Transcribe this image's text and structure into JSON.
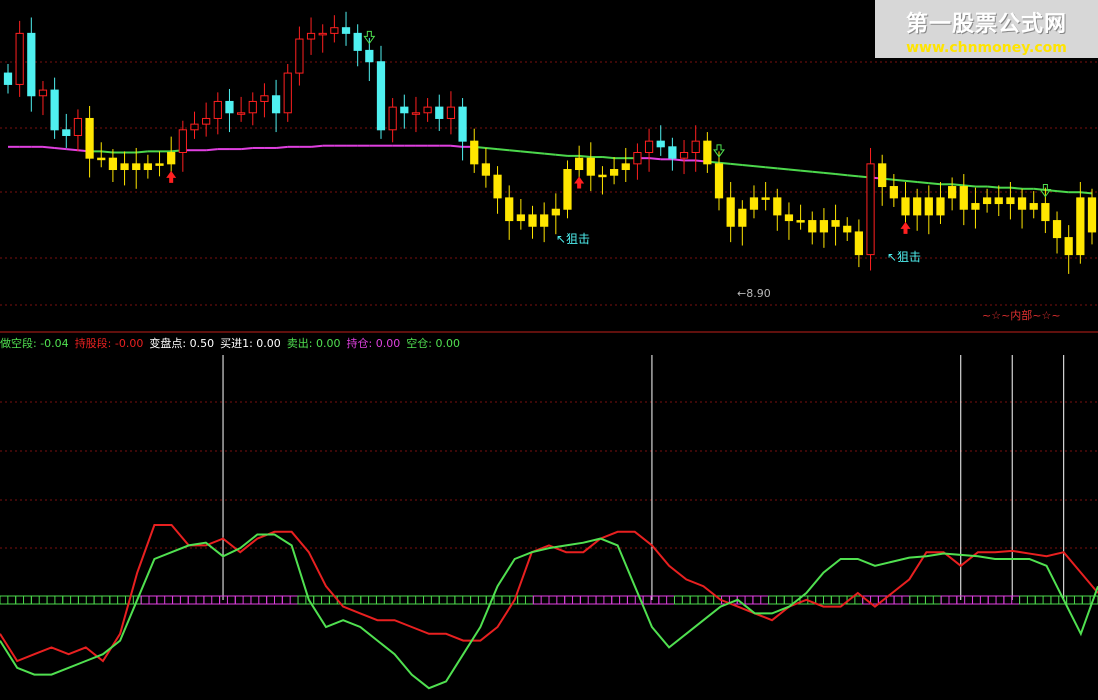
{
  "watermark": {
    "title": "第一股票公式网",
    "url": "www.chnmoney.com"
  },
  "colors": {
    "background": "#000000",
    "up": "#ff2020",
    "down": "#4ff0f0",
    "weak": "#ffe600",
    "ma_upper": "#e040e0",
    "ma_lower": "#4cd84c",
    "grid": "#7a1010",
    "line_red": "#e82020",
    "line_green": "#50e050"
  },
  "legend": [
    {
      "label": "做空段:",
      "value": "-0.04",
      "color": "#50e050"
    },
    {
      "label": "持股段:",
      "value": "-0.00",
      "color": "#e82020"
    },
    {
      "label": "变盘点:",
      "value": "0.50",
      "color": "#ffffff"
    },
    {
      "label": "买进1:",
      "value": "0.00",
      "color": "#ffffff"
    },
    {
      "label": "卖出:",
      "value": "0.00",
      "color": "#50e050"
    },
    {
      "label": "持仓:",
      "value": "0.00",
      "color": "#e040e0"
    },
    {
      "label": "空仓:",
      "value": "0.00",
      "color": "#50e050"
    }
  ],
  "annotations": {
    "snipe1": "↖狙击",
    "snipe2": "↖狙击",
    "low": "←8.90",
    "inner": "~☆~内部~☆~"
  },
  "chart_data": [
    {
      "type": "candlestick",
      "title": "",
      "ylim": [
        8.6,
        11.2
      ],
      "low_label": 8.9,
      "price": {
        "opens": [
          10.6,
          10.5,
          10.95,
          10.4,
          10.45,
          10.1,
          10.05,
          10.2,
          9.85,
          9.85,
          9.75,
          9.8,
          9.75,
          9.8,
          9.8,
          9.9,
          10.1,
          10.15,
          10.2,
          10.35,
          10.25,
          10.25,
          10.35,
          10.4,
          10.25,
          10.6,
          10.9,
          10.95,
          10.95,
          11.0,
          10.95,
          10.8,
          10.7,
          10.1,
          10.3,
          10.25,
          10.25,
          10.3,
          10.2,
          10.3,
          10.0,
          9.8,
          9.7,
          9.5,
          9.3,
          9.35,
          9.25,
          9.35,
          9.4,
          9.75,
          9.85,
          9.7,
          9.7,
          9.75,
          9.8,
          9.9,
          10.0,
          9.95,
          9.85,
          9.9,
          10.0,
          9.8,
          9.5,
          9.25,
          9.4,
          9.5,
          9.5,
          9.35,
          9.3,
          9.3,
          9.2,
          9.3,
          9.25,
          9.2,
          9.0,
          9.8,
          9.6,
          9.5,
          9.35,
          9.5,
          9.35,
          9.5,
          9.6,
          9.4,
          9.45,
          9.5,
          9.45,
          9.5,
          9.4,
          9.45,
          9.3,
          9.15,
          9.0,
          9.5
        ],
        "closes": [
          10.5,
          10.95,
          10.4,
          10.45,
          10.1,
          10.05,
          10.2,
          9.85,
          9.85,
          9.75,
          9.8,
          9.75,
          9.8,
          9.8,
          9.9,
          10.1,
          10.15,
          10.2,
          10.35,
          10.25,
          10.25,
          10.35,
          10.4,
          10.25,
          10.6,
          10.9,
          10.95,
          10.95,
          11.0,
          10.95,
          10.8,
          10.7,
          10.1,
          10.3,
          10.25,
          10.25,
          10.3,
          10.2,
          10.3,
          10.0,
          9.8,
          9.7,
          9.5,
          9.3,
          9.35,
          9.25,
          9.35,
          9.4,
          9.75,
          9.85,
          9.7,
          9.7,
          9.75,
          9.8,
          9.9,
          10.0,
          9.95,
          9.85,
          9.9,
          10.0,
          9.8,
          9.5,
          9.25,
          9.4,
          9.5,
          9.5,
          9.35,
          9.3,
          9.3,
          9.2,
          9.3,
          9.25,
          9.2,
          9.0,
          9.8,
          9.6,
          9.5,
          9.35,
          9.5,
          9.35,
          9.5,
          9.6,
          9.4,
          9.45,
          9.5,
          9.45,
          9.5,
          9.4,
          9.45,
          9.3,
          9.15,
          9.0,
          9.5,
          9.2
        ],
        "ma": [
          9.95,
          9.95,
          9.95,
          9.95,
          9.94,
          9.93,
          9.92,
          9.91,
          9.91,
          9.9,
          9.9,
          9.9,
          9.91,
          9.91,
          9.91,
          9.92,
          9.92,
          9.92,
          9.93,
          9.93,
          9.93,
          9.94,
          9.94,
          9.94,
          9.95,
          9.95,
          9.95,
          9.96,
          9.96,
          9.96,
          9.96,
          9.96,
          9.96,
          9.96,
          9.96,
          9.96,
          9.96,
          9.96,
          9.96,
          9.95,
          9.95,
          9.94,
          9.93,
          9.92,
          9.91,
          9.9,
          9.89,
          9.88,
          9.87,
          9.87,
          9.86,
          9.86,
          9.85,
          9.85,
          9.85,
          9.85,
          9.84,
          9.84,
          9.83,
          9.83,
          9.82,
          9.81,
          9.8,
          9.79,
          9.78,
          9.77,
          9.76,
          9.75,
          9.74,
          9.73,
          9.72,
          9.71,
          9.7,
          9.69,
          9.68,
          9.67,
          9.66,
          9.65,
          9.64,
          9.63,
          9.62,
          9.62,
          9.61,
          9.6,
          9.6,
          9.59,
          9.59,
          9.58,
          9.58,
          9.57,
          9.56,
          9.55,
          9.55,
          9.54
        ]
      }
    },
    {
      "type": "line",
      "title": "",
      "ylim": [
        -1,
        1.5
      ],
      "series": [
        {
          "values": [
            -0.55,
            -0.75,
            -0.7,
            -0.65,
            -0.7,
            -0.65,
            -0.75,
            -0.55,
            -0.1,
            0.25,
            0.25,
            0.1,
            0.1,
            0.15,
            0.05,
            0.15,
            0.2,
            0.2,
            0.05,
            -0.2,
            -0.35,
            -0.4,
            -0.45,
            -0.45,
            -0.5,
            -0.55,
            -0.55,
            -0.6,
            -0.6,
            -0.5,
            -0.3,
            0.05,
            0.1,
            0.05,
            0.05,
            0.15,
            0.2,
            0.2,
            0.1,
            -0.05,
            -0.15,
            -0.2,
            -0.3,
            -0.35,
            -0.4,
            -0.45,
            -0.35,
            -0.3,
            -0.35,
            -0.35,
            -0.25,
            -0.35,
            -0.25,
            -0.15,
            0.05,
            0.05,
            -0.05,
            0.05,
            0.05,
            0.06,
            0.04,
            0.02,
            0.05,
            -0.1,
            -0.25
          ]
        },
        {
          "values": [
            -0.6,
            -0.8,
            -0.85,
            -0.85,
            -0.8,
            -0.75,
            -0.7,
            -0.6,
            -0.3,
            0.0,
            0.05,
            0.1,
            0.12,
            0.02,
            0.08,
            0.18,
            0.18,
            0.1,
            -0.3,
            -0.5,
            -0.45,
            -0.5,
            -0.6,
            -0.7,
            -0.85,
            -0.95,
            -0.9,
            -0.7,
            -0.5,
            -0.2,
            0.0,
            0.05,
            0.08,
            0.1,
            0.12,
            0.15,
            0.1,
            -0.2,
            -0.5,
            -0.65,
            -0.55,
            -0.45,
            -0.35,
            -0.3,
            -0.4,
            -0.4,
            -0.35,
            -0.25,
            -0.1,
            0.0,
            0.0,
            -0.05,
            -0.02,
            0.01,
            0.02,
            0.04,
            0.03,
            0.02,
            0.0,
            0.0,
            0.0,
            -0.05,
            -0.3,
            -0.55,
            -0.2
          ]
        }
      ],
      "signal_lines_idx": [
        13,
        38,
        56,
        59,
        62,
        69
      ],
      "baseline_state": [
        0,
        0,
        0,
        0,
        0,
        0,
        0,
        0,
        0,
        1,
        1,
        1,
        1,
        1,
        1,
        1,
        1,
        1,
        1,
        0,
        0,
        0,
        0,
        0,
        0,
        0,
        0,
        0,
        0,
        0,
        0,
        0,
        0,
        0,
        1,
        1,
        1,
        1,
        1,
        1,
        1,
        1,
        1,
        0,
        0,
        0,
        1,
        1,
        1,
        0,
        0,
        0,
        0,
        0,
        0,
        1,
        1,
        1,
        0,
        0,
        1,
        1,
        1,
        1,
        1,
        0,
        0,
        0,
        0,
        0
      ]
    }
  ]
}
